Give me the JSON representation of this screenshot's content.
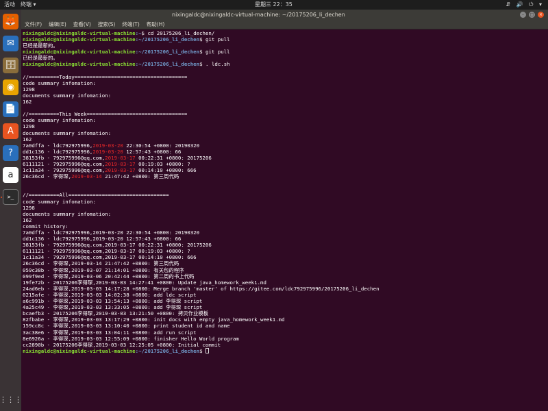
{
  "topbar": {
    "activities": "活动",
    "app_menu": "终端 ▾",
    "clock": "星期三 22：35",
    "tray": "⇵ 🔊 ⏻ ▾"
  },
  "dock": {
    "items": [
      {
        "name": "firefox-icon",
        "glyph": "🦊",
        "color": "#e66000"
      },
      {
        "name": "thunderbird-icon",
        "glyph": "✉",
        "color": "#2a6fbb"
      },
      {
        "name": "files-icon",
        "glyph": "🗄",
        "color": "#8a6d3b"
      },
      {
        "name": "rhythmbox-icon",
        "glyph": "◉",
        "color": "#e8a400"
      },
      {
        "name": "writer-icon",
        "glyph": "📄",
        "color": "#2a6fbb"
      },
      {
        "name": "software-icon",
        "glyph": "A",
        "color": "#e95420"
      },
      {
        "name": "help-icon",
        "glyph": "?",
        "color": "#2a6fbb"
      },
      {
        "name": "amazon-icon",
        "glyph": "a",
        "color": "#ffffff"
      },
      {
        "name": "terminal-icon",
        "glyph": ">_",
        "color": "#2c2c2c"
      }
    ],
    "apps_grid": "⋮⋮⋮"
  },
  "window": {
    "title": "nixingaldc@nixingaldc-virtual-machine: ~/20175206_li_dechen",
    "menu": [
      "文件(F)",
      "编辑(E)",
      "查看(V)",
      "搜索(S)",
      "终端(T)",
      "帮助(H)"
    ]
  },
  "terminal": {
    "lines": [
      {
        "user": "nixingaldc@nixingaldc-virtual-machine",
        "path": ":~",
        "cmd": "$ cd 20175206_li_dechen/"
      },
      {
        "user": "nixingaldc@nixingaldc-virtual-machine",
        "path": ":~/20175206_li_dechen",
        "cmd": "$ git pull"
      },
      {
        "text": "已经是最新的。"
      },
      {
        "user": "nixingaldc@nixingaldc-virtual-machine",
        "path": ":~/20175206_li_dechen",
        "cmd": "$ git pull"
      },
      {
        "text": "已经是最新的。"
      },
      {
        "user": "nixingaldc@nixingaldc-virtual-machine",
        "path": ":~/20175206_li_dechen",
        "cmd": "$ . ldc.sh"
      },
      {
        "text": ""
      },
      {
        "text": "//==========Today====================================="
      },
      {
        "text": "code summary infomation:"
      },
      {
        "text": "1298"
      },
      {
        "text": "documents summary infomation:"
      },
      {
        "text": "162"
      },
      {
        "text": ""
      },
      {
        "text": "//==========This Week================================="
      },
      {
        "text": "code summary infomation:"
      },
      {
        "text": "1298"
      },
      {
        "text": "documents summary infomation:"
      },
      {
        "text": "162"
      },
      {
        "pre": "7a0dffa - ldc792975996,",
        "date": "2019-03-20",
        "post": " 22:30:54 +0800: 20190320"
      },
      {
        "pre": "dd1c136 - ldc792975996,",
        "date": "2019-03-20",
        "post": " 12:57:43 +0800: 66"
      },
      {
        "pre": "38153fb - 792975996@qq.com,",
        "date": "2019-03-17",
        "post": " 00:22:31 +0800: 20175206"
      },
      {
        "pre": "6111121 - 792975996@qq.com,",
        "date": "2019-03-17",
        "post": " 00:19:03 +0800: ?"
      },
      {
        "pre": "1c11a34 - 792975996@qq.com,",
        "date": "2019-03-17",
        "post": " 00:14:10 +0800: 666"
      },
      {
        "pre": "26c36cd - 李得琛,",
        "date": "2019-03-14",
        "post": " 21:47:42 +0800: 第三周代码"
      },
      {
        "text": ""
      },
      {
        "text": ""
      },
      {
        "text": "//==========All================================="
      },
      {
        "text": "code summary infomation:"
      },
      {
        "text": "1298"
      },
      {
        "text": "documents summary infomation:"
      },
      {
        "text": "162"
      },
      {
        "text": "commit history:"
      },
      {
        "text": "7a0dffa - ldc792975996,2019-03-20 22:30:54 +0800: 20190320"
      },
      {
        "text": "dd1c136 - ldc792975996,2019-03-20 12:57:43 +0800: 66"
      },
      {
        "text": "38153fb - 792975996@qq.com,2019-03-17 00:22:31 +0800: 20175206"
      },
      {
        "text": "6111121 - 792975996@qq.com,2019-03-17 00:19:03 +0800: ?"
      },
      {
        "text": "1c11a34 - 792975996@qq.com,2019-03-17 00:14:10 +0800: 666"
      },
      {
        "text": "26c36cd - 李得琛,2019-03-14 21:47:42 +0800: 第三周代码"
      },
      {
        "text": "059c38b - 李得琛,2019-03-07 21:14:01 +0800: 有关包的程序"
      },
      {
        "text": "099f9ed - 李得琛,2019-03-06 20:42:44 +0800: 第二周的书上代码"
      },
      {
        "text": "19fe72b - 20175206李得琛,2019-03-03 14:27:41 +0800: Update java_homework_week1.md"
      },
      {
        "text": "24ad6eb - 李得琛,2019-03-03 14:17:28 +0800: Merge branch 'master' of https://gitee.com/ldc792975996/20175206_li_dechen"
      },
      {
        "text": "0215afe - 李得琛,2019-03-03 14:02:38 +0800: add ldc script"
      },
      {
        "text": "a6c991b - 李得琛,2019-03-03 13:54:13 +0800: add 李得琛 script"
      },
      {
        "text": "4a25c49 - 李得琛,2019-03-03 13:33:05 +0800: add 李得琛 script"
      },
      {
        "text": "bcaefb3 - 20175206李得琛,2019-03-03 13:21:50 +0800: 拷贝作业模板"
      },
      {
        "text": "82fbabe - 李得琛,2019-03-03 13:17:29 +0800: init docs with empty java_homework_week1.md"
      },
      {
        "text": "159cc8c - 李得琛,2019-03-03 13:10:40 +0800: print student id and name"
      },
      {
        "text": "3ac38e6 - 李得琛,2019-03-03 13:04:11 +0800: add run script"
      },
      {
        "text": "8e6926a - 李得琛,2019-03-03 12:55:09 +0800: finisher Hello World program"
      },
      {
        "text": "cc2890b - 20175206李得琛,2019-03-03 12:25:05 +0800: Initial commit"
      },
      {
        "user": "nixingaldc@nixingaldc-virtual-machine",
        "path": ":~/20175206_li_dechen",
        "cmd": "$ ",
        "cursor": true
      }
    ]
  }
}
